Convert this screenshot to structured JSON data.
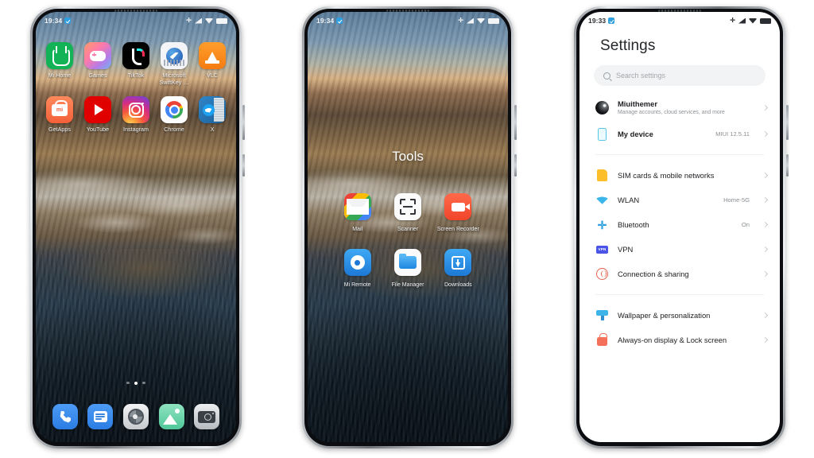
{
  "phones": {
    "phone1": {
      "name": "home-screen",
      "statusbar": {
        "time": "19:34",
        "icons": [
          "checkbox-badge-icon",
          "bluetooth-icon",
          "signal-icon",
          "wifi-icon",
          "battery-icon"
        ]
      },
      "rows": [
        [
          {
            "label": "Mi Home",
            "icon": "mi-home-icon"
          },
          {
            "label": "Games",
            "icon": "games-icon"
          },
          {
            "label": "TikTok",
            "icon": "tiktok-icon"
          },
          {
            "label": "Microsoft SwiftKey …",
            "icon": "swiftkey-icon"
          },
          {
            "label": "VLC",
            "icon": "vlc-icon"
          }
        ],
        [
          {
            "label": "GetApps",
            "icon": "getapps-icon"
          },
          {
            "label": "YouTube",
            "icon": "youtube-icon"
          },
          {
            "label": "Instagram",
            "icon": "instagram-icon"
          },
          {
            "label": "Chrome",
            "icon": "chrome-icon"
          },
          {
            "label": "X",
            "icon": "x-twitter-icon"
          }
        ]
      ],
      "dock": [
        {
          "name": "phone-icon"
        },
        {
          "name": "messages-icon"
        },
        {
          "name": "settings-icon"
        },
        {
          "name": "gallery-icon"
        },
        {
          "name": "camera-icon"
        }
      ],
      "page_indicator": {
        "pages": 3,
        "active": 2
      }
    },
    "phone2": {
      "name": "folder-screen",
      "statusbar": {
        "time": "19:34"
      },
      "folder_title": "Tools",
      "rows": [
        [
          {
            "label": "Mail",
            "icon": "mail-icon"
          },
          {
            "label": "Scanner",
            "icon": "scanner-icon"
          },
          {
            "label": "Screen Recorder",
            "icon": "screen-recorder-icon"
          }
        ],
        [
          {
            "label": "Mi Remote",
            "icon": "mi-remote-icon"
          },
          {
            "label": "File Manager",
            "icon": "file-manager-icon"
          },
          {
            "label": "Downloads",
            "icon": "downloads-icon"
          }
        ]
      ]
    },
    "phone3": {
      "name": "settings-screen",
      "statusbar": {
        "time": "19:33"
      },
      "title": "Settings",
      "search": {
        "placeholder": "Search settings",
        "icon": "search-icon"
      },
      "groups": [
        {
          "rows": [
            {
              "label": "Miuithemer",
              "sub": "Manage accounts, cloud services, and more",
              "value": "",
              "icon": "avatar"
            },
            {
              "label": "My device",
              "sub": "",
              "value": "MIUI 12.5.11",
              "icon": "device-icon"
            }
          ]
        },
        {
          "rows": [
            {
              "label": "SIM cards & mobile networks",
              "sub": "",
              "value": "",
              "icon": "sim-icon"
            },
            {
              "label": "WLAN",
              "sub": "",
              "value": "Home-5G",
              "icon": "wifi-icon"
            },
            {
              "label": "Bluetooth",
              "sub": "",
              "value": "On",
              "icon": "bluetooth-icon"
            },
            {
              "label": "VPN",
              "sub": "",
              "value": "",
              "icon": "vpn-icon"
            },
            {
              "label": "Connection & sharing",
              "sub": "",
              "value": "",
              "icon": "connection-sharing-icon"
            }
          ]
        },
        {
          "rows": [
            {
              "label": "Wallpaper & personalization",
              "sub": "",
              "value": "",
              "icon": "wallpaper-icon"
            },
            {
              "label": "Always-on display & Lock screen",
              "sub": "",
              "value": "",
              "icon": "lock-icon"
            }
          ]
        }
      ]
    }
  }
}
